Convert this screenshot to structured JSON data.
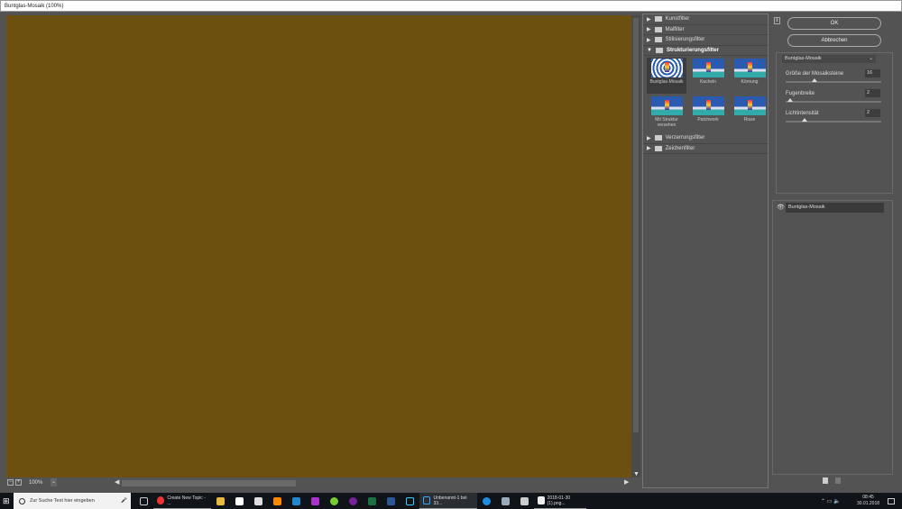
{
  "window": {
    "title": "Buntglas-Mosaik (100%)"
  },
  "canvas": {
    "color": "#6b500f",
    "zoom": "100%"
  },
  "filters": {
    "categories": [
      {
        "label": "Kunstfilter"
      },
      {
        "label": "Malfilter"
      },
      {
        "label": "Stilisierungsfilter"
      },
      {
        "label": "Strukturierungsfilter",
        "expanded": true
      }
    ],
    "thumbs": [
      {
        "label": "Buntglas-Mosaik",
        "selected": true
      },
      {
        "label": "Kacheln"
      },
      {
        "label": "Körnung"
      },
      {
        "label": "Mit Struktur versehen"
      },
      {
        "label": "Patchwork"
      },
      {
        "label": "Risse"
      }
    ],
    "after": [
      {
        "label": "Verzerrungsfilter"
      },
      {
        "label": "Zeichenfilter"
      }
    ]
  },
  "buttons": {
    "ok": "OK",
    "cancel": "Abbrechen"
  },
  "settings": {
    "filter": "Buntglas-Mosaik",
    "params": [
      {
        "label": "Größe der Mosaiksteine",
        "value": "16",
        "slider": 0.3
      },
      {
        "label": "Fugenbreite",
        "value": "2",
        "slider": 0.05
      },
      {
        "label": "Lichtintensität",
        "value": "2",
        "slider": 0.2
      }
    ]
  },
  "layers": {
    "item": "Buntglas-Mosaik"
  },
  "taskbar": {
    "search_placeholder": "Zur Suche Text hier eingeben",
    "chrome": "Create New Topic - ...",
    "photoshop": "Unbenannt-1 bei 33...",
    "photos": "2018-01-30 (1).png...",
    "time": "08:45",
    "date": "30.01.2018"
  }
}
